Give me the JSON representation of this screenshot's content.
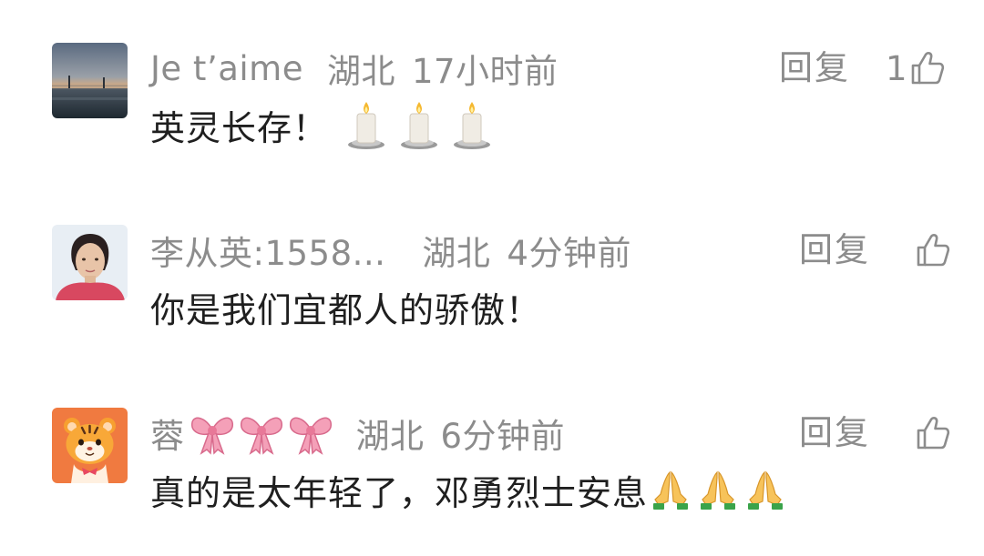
{
  "comments": [
    {
      "author": "Je t’aime",
      "region": "湖北",
      "time": "17小时前",
      "reply_label": "回复",
      "like_count": "1",
      "text": "英灵长存！",
      "avatar_icon": "sunset-sea-photo",
      "text_emoji": "candle-icon"
    },
    {
      "author": "李从英:1558...",
      "region": "湖北",
      "time": "4分钟前",
      "reply_label": "回复",
      "like_count": "",
      "text": "你是我们宜都人的骄傲！",
      "avatar_icon": "woman-portrait-photo"
    },
    {
      "author": "蓉",
      "region": "湖北",
      "time": "6分钟前",
      "reply_label": "回复",
      "like_count": "",
      "text": "真的是太年轻了，邓勇烈士安息",
      "avatar_icon": "tiger-cartoon",
      "name_emoji": "ribbon-bow-icon",
      "text_emoji": "praying-hands-icon"
    }
  ],
  "colors": {
    "meta_text": "#8c8c8c",
    "body_text": "#1f1f1f",
    "background": "#ffffff"
  }
}
